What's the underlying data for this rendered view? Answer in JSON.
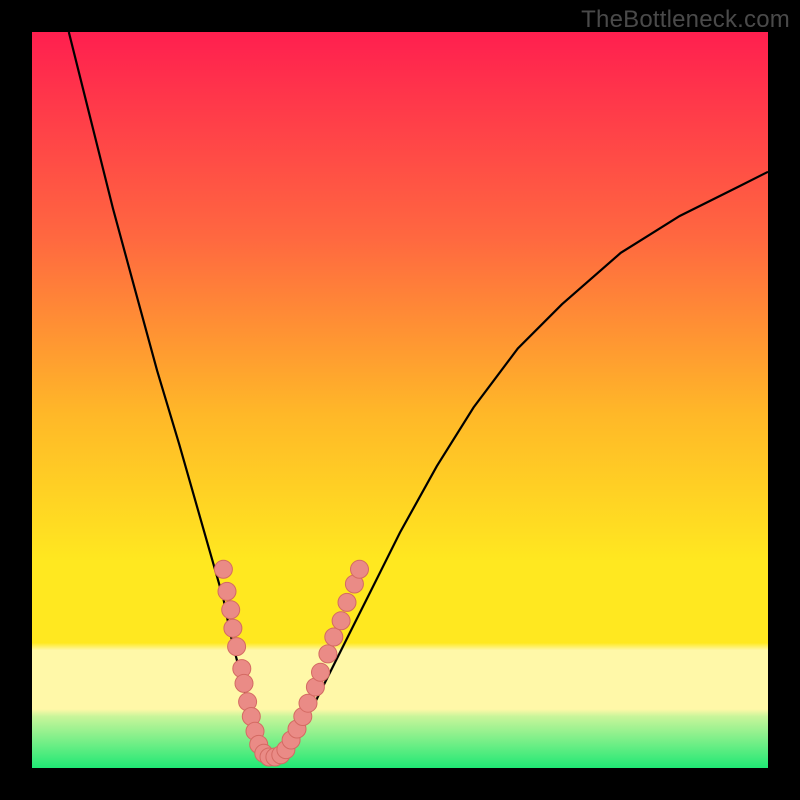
{
  "watermark": "TheBottleneck.com",
  "colors": {
    "frame": "#000000",
    "grad_top": "#ff1f4f",
    "grad_mid1": "#ff6840",
    "grad_mid2": "#ffb828",
    "grad_mid3": "#ffe820",
    "grad_band_pale": "#fff8a8",
    "grad_green": "#1fe874",
    "curve": "#000000",
    "dot_fill": "#ea8b86",
    "dot_stroke": "#d46a63"
  },
  "chart_data": {
    "type": "line",
    "title": "",
    "xlabel": "",
    "ylabel": "",
    "xlim": [
      0,
      100
    ],
    "ylim": [
      0,
      100
    ],
    "series": [
      {
        "name": "bottleneck-curve",
        "x": [
          5,
          8,
          11,
          14,
          17,
          20,
          22,
          24,
          26,
          27,
          28.5,
          30,
          31,
          32,
          33,
          35,
          38,
          42,
          46,
          50,
          55,
          60,
          66,
          72,
          80,
          88,
          96,
          100
        ],
        "y": [
          100,
          88,
          76,
          65,
          54,
          44,
          37,
          30,
          23,
          18,
          12,
          6,
          3,
          1.5,
          1.5,
          3,
          8,
          16,
          24,
          32,
          41,
          49,
          57,
          63,
          70,
          75,
          79,
          81
        ]
      }
    ],
    "points": [
      {
        "name": "left-cluster",
        "coords": [
          {
            "x": 26.0,
            "y": 27
          },
          {
            "x": 26.5,
            "y": 24
          },
          {
            "x": 27.0,
            "y": 21.5
          },
          {
            "x": 27.3,
            "y": 19
          },
          {
            "x": 27.8,
            "y": 16.5
          },
          {
            "x": 28.5,
            "y": 13.5
          },
          {
            "x": 28.8,
            "y": 11.5
          },
          {
            "x": 29.3,
            "y": 9
          },
          {
            "x": 29.8,
            "y": 7
          },
          {
            "x": 30.3,
            "y": 5
          }
        ]
      },
      {
        "name": "bottom-cluster",
        "coords": [
          {
            "x": 30.8,
            "y": 3.2
          },
          {
            "x": 31.5,
            "y": 2.0
          },
          {
            "x": 32.2,
            "y": 1.5
          },
          {
            "x": 33.0,
            "y": 1.5
          },
          {
            "x": 33.8,
            "y": 1.8
          },
          {
            "x": 34.5,
            "y": 2.5
          }
        ]
      },
      {
        "name": "right-cluster",
        "coords": [
          {
            "x": 35.2,
            "y": 3.8
          },
          {
            "x": 36.0,
            "y": 5.3
          },
          {
            "x": 36.8,
            "y": 7.0
          },
          {
            "x": 37.5,
            "y": 8.8
          },
          {
            "x": 38.5,
            "y": 11.0
          },
          {
            "x": 39.2,
            "y": 13.0
          },
          {
            "x": 40.2,
            "y": 15.5
          },
          {
            "x": 41.0,
            "y": 17.8
          },
          {
            "x": 42.0,
            "y": 20.0
          },
          {
            "x": 42.8,
            "y": 22.5
          },
          {
            "x": 43.8,
            "y": 25.0
          },
          {
            "x": 44.5,
            "y": 27.0
          }
        ]
      }
    ]
  }
}
